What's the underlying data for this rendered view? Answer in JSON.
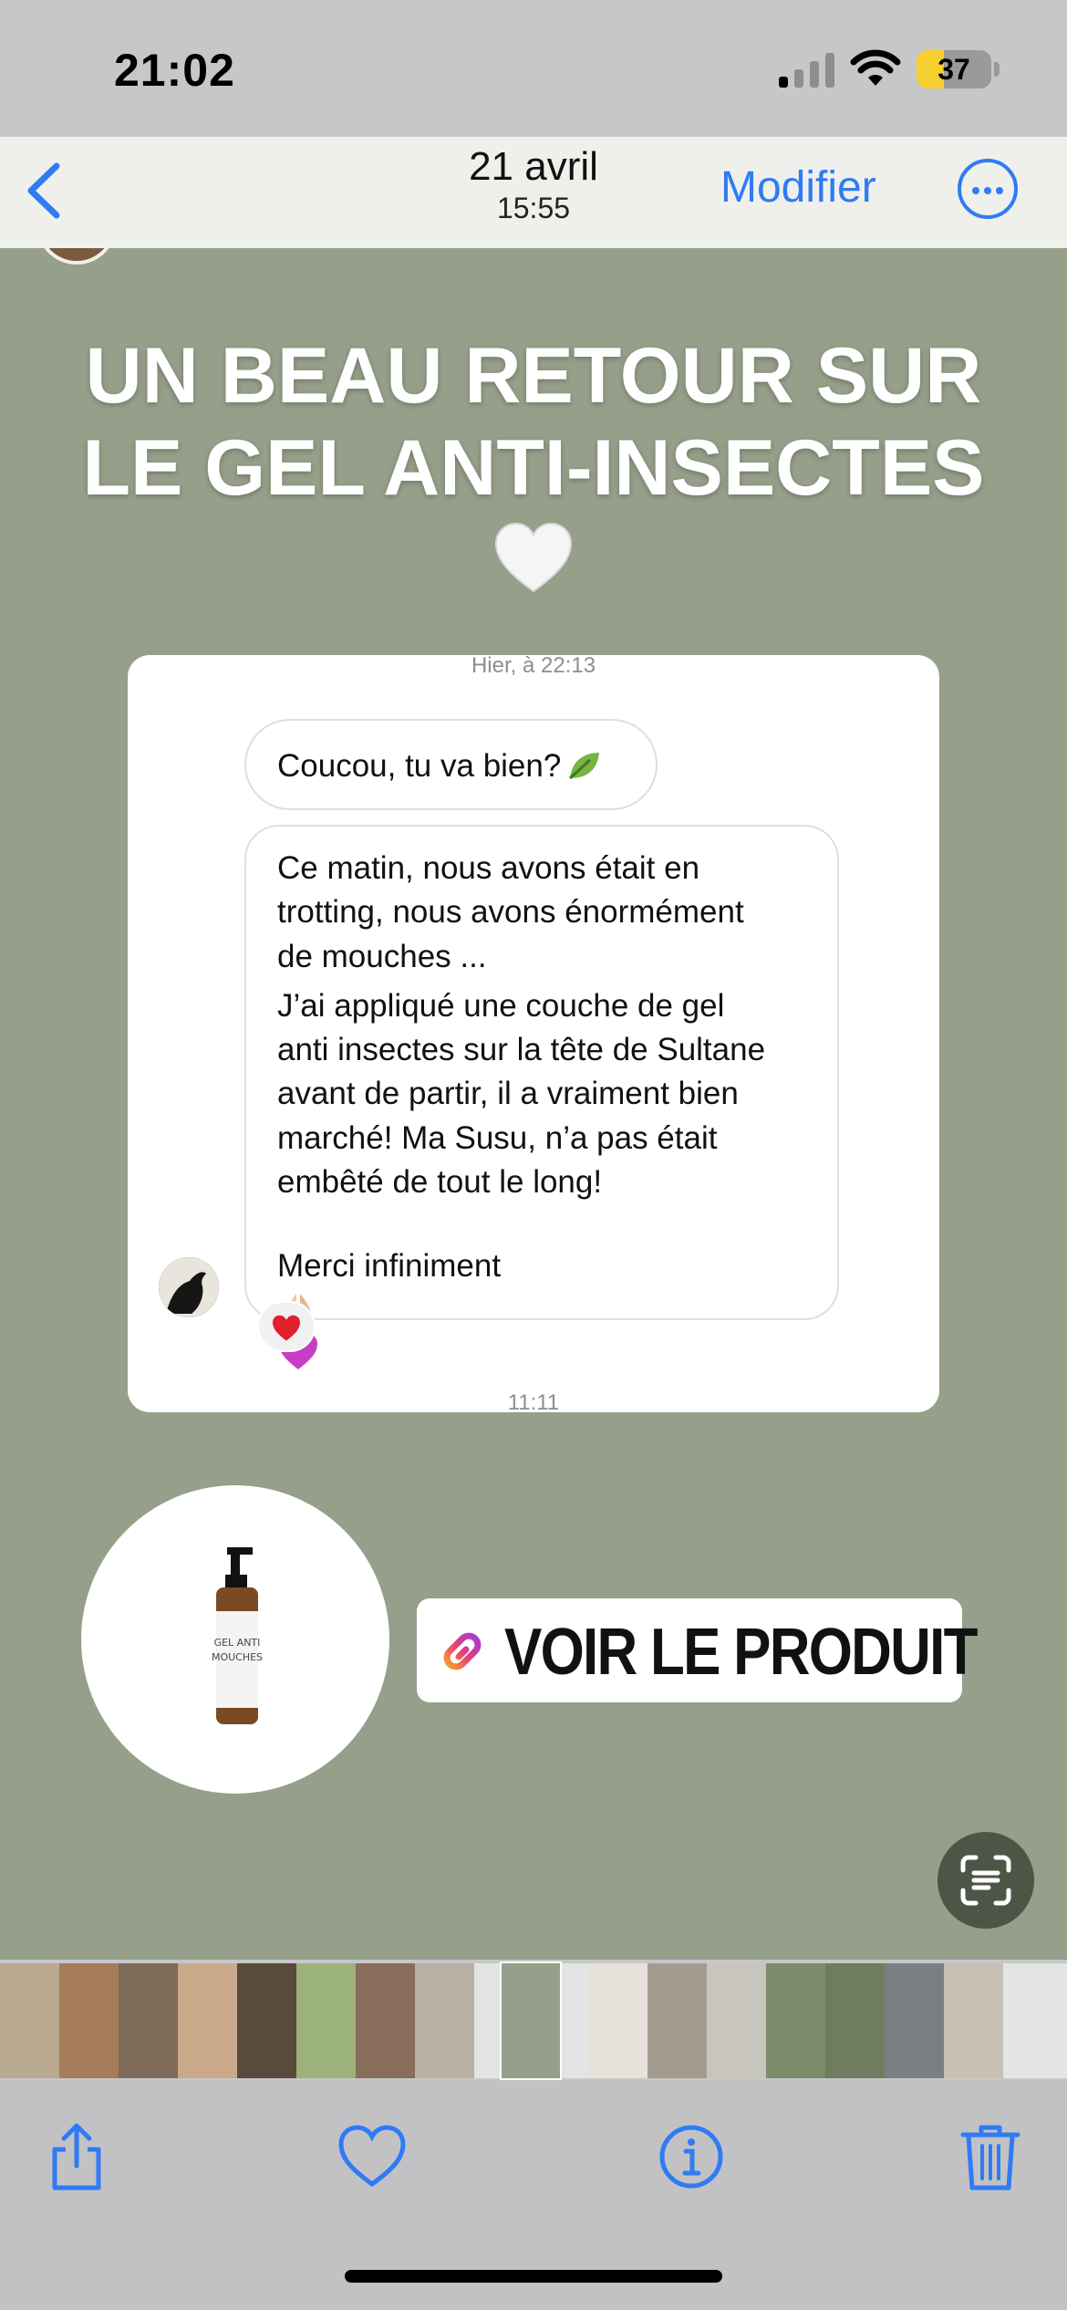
{
  "status_bar": {
    "time": "21:02",
    "battery_level": "37",
    "battery_percent": 37
  },
  "nav": {
    "back_icon": "chevron-left-icon",
    "date": "21 avril",
    "time": "15:55",
    "edit_label": "Modifier",
    "more_icon": "ellipsis-circle-icon"
  },
  "story": {
    "background_color": "#959f89",
    "headline_line1": "UN BEAU RETOUR SUR",
    "headline_line2": "LE GEL ANTI-INSECTES",
    "chat": {
      "timestamp_top": "Hier, à 22:13",
      "message_1": "Coucou, tu va bien?",
      "message_2_para1": "Ce matin, nous avons était en\ntrotting, nous avons énormément\nde mouches ...",
      "message_2_para2": "J’ai appliqué une couche de gel\nanti insectes sur la tête de Sultane\navant de partir, il a vraiment bien\nmarché! Ma Susu, n’a pas était\nembêté de tout le long!",
      "message_2_para3": "Merci infiniment",
      "reaction": "❤️",
      "timestamp_bottom": "11:11"
    },
    "product_label": "GEL ANTI MOUCHES",
    "link_button": "VOIR LE PRODUIT",
    "scan_icon": "live-text-scan-icon"
  },
  "toolbar": {
    "share_icon": "share-icon",
    "favorite_icon": "heart-icon",
    "info_icon": "info-icon",
    "delete_icon": "trash-icon"
  },
  "thumbnails": [
    {
      "color": "#b9a98f"
    },
    {
      "color": "#a57d5a"
    },
    {
      "color": "#7d6a58"
    },
    {
      "color": "#c9a98a"
    },
    {
      "color": "#5a4a3c"
    },
    {
      "color": "#9bb27a"
    },
    {
      "color": "#8a6e5c"
    },
    {
      "color": "#b7b0a3"
    },
    {
      "color": "#959f89"
    },
    {
      "color": "#e6e2da"
    },
    {
      "color": "#a39c8e"
    },
    {
      "color": "#c8c5bd"
    },
    {
      "color": "#7c8b6a"
    },
    {
      "color": "#6f7d5e"
    },
    {
      "color": "#7b7f84"
    },
    {
      "color": "#c9c0b4"
    }
  ]
}
